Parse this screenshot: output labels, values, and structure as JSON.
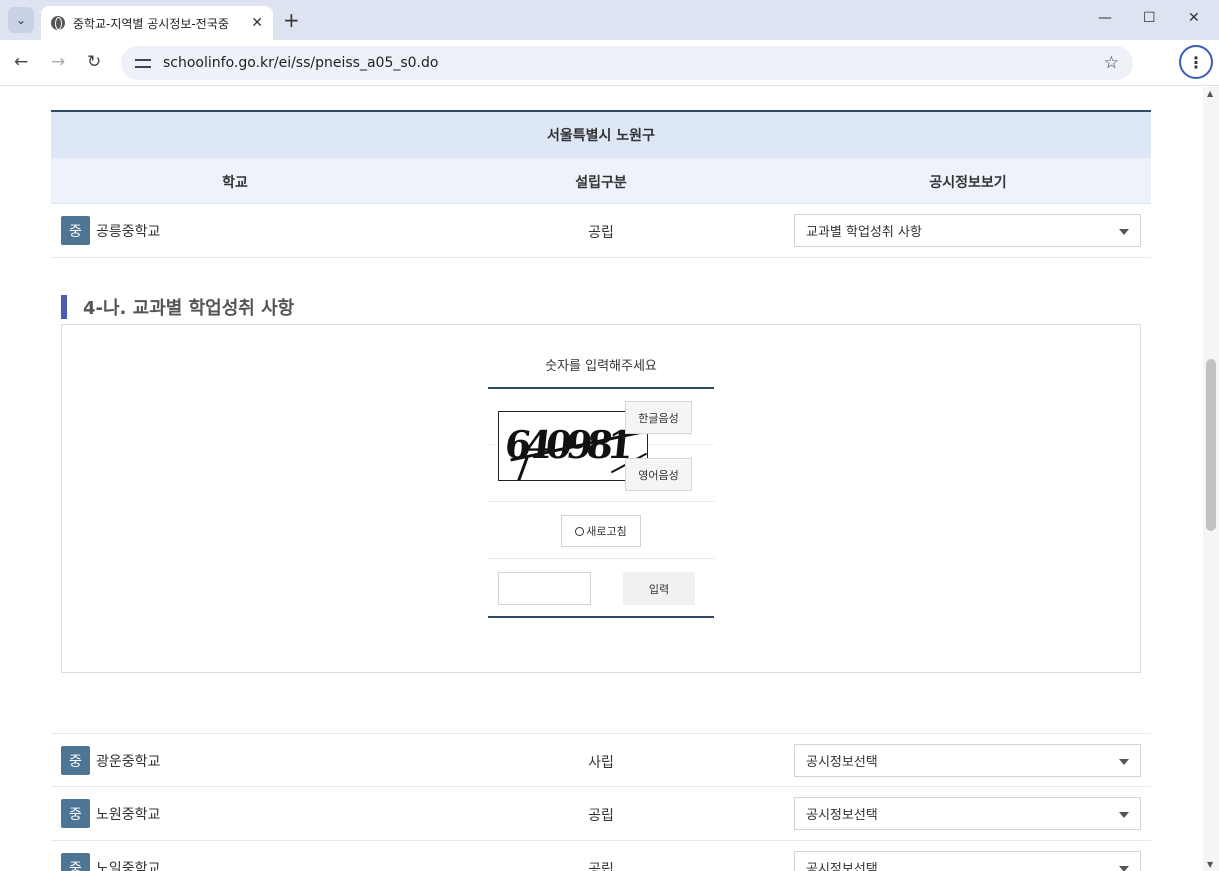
{
  "browser": {
    "tab_title": "중학교-지역별 공시정보-전국중",
    "tab_close": "✕",
    "new_tab": "+",
    "url": "schoolinfo.go.kr/ei/ss/pneiss_a05_s0.do",
    "icons": [
      "tab-list-icon",
      "globe-icon",
      "close-icon",
      "back-icon",
      "forward-icon",
      "reload-icon",
      "site-settings-icon",
      "bookmark-star-icon",
      "kebab-menu-icon",
      "minimize-icon",
      "maximize-icon",
      "window-close-icon"
    ]
  },
  "table": {
    "region": "서울특별시 노원구",
    "headers": {
      "school": "학교",
      "type": "설립구분",
      "info": "공시정보보기"
    },
    "rows": [
      {
        "badge": "중",
        "name": "공릉중학교",
        "type": "공립",
        "selected": "교과별 학업성취 사항"
      },
      {
        "badge": "중",
        "name": "광운중학교",
        "type": "사립",
        "selected": "공시정보선택"
      },
      {
        "badge": "중",
        "name": "노원중학교",
        "type": "공립",
        "selected": "공시정보선택"
      },
      {
        "badge": "중",
        "name": "노일중학교",
        "type": "공립",
        "selected": "공시정보선택"
      }
    ]
  },
  "section": {
    "title": "4-나. 교과별 학업성취 사항"
  },
  "captcha": {
    "prompt": "숫자를 입력해주세요",
    "image_text": "640981",
    "korean_voice": "한글음성",
    "english_voice": "영어음성",
    "refresh": "새로고침",
    "answer_value": "",
    "submit": "입력"
  },
  "colors": {
    "badge": "#4e7594",
    "header_bg": "#dde7f6",
    "accent_bar": "#4a5cb5",
    "border_dark": "#2d4a6b"
  }
}
